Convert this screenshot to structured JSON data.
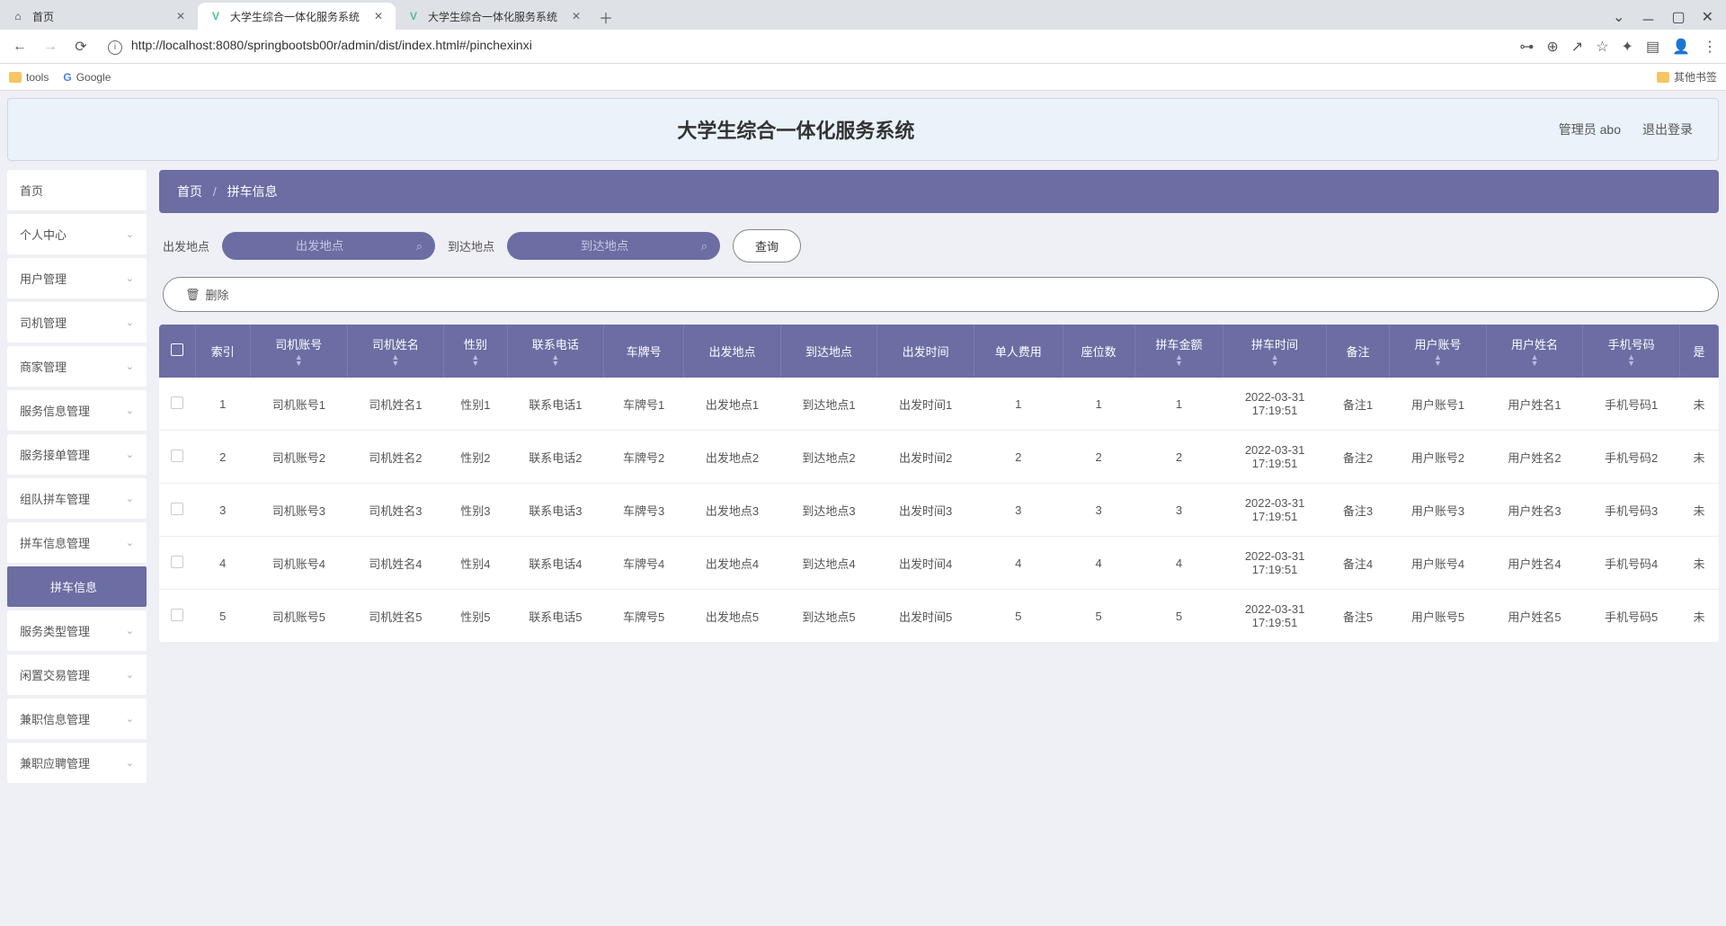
{
  "browser": {
    "tabs": [
      {
        "icon": "⌂",
        "label": "首页"
      },
      {
        "icon": "V",
        "label": "大学生综合一体化服务系统"
      },
      {
        "icon": "V",
        "label": "大学生综合一体化服务系统"
      }
    ],
    "url": "http://localhost:8080/springbootsb00r/admin/dist/index.html#/pinchexinxi",
    "bookmarks": {
      "tools": "tools",
      "google": "Google",
      "other": "其他书签"
    }
  },
  "header": {
    "title": "大学生综合一体化服务系统",
    "admin": "管理员 abo",
    "logout": "退出登录"
  },
  "sidebar": {
    "items": [
      {
        "label": "首页",
        "expandable": false
      },
      {
        "label": "个人中心",
        "expandable": true
      },
      {
        "label": "用户管理",
        "expandable": true
      },
      {
        "label": "司机管理",
        "expandable": true
      },
      {
        "label": "商家管理",
        "expandable": true
      },
      {
        "label": "服务信息管理",
        "expandable": true
      },
      {
        "label": "服务接单管理",
        "expandable": true
      },
      {
        "label": "组队拼车管理",
        "expandable": true
      },
      {
        "label": "拼车信息管理",
        "expandable": true,
        "sub": {
          "label": "拼车信息"
        }
      },
      {
        "label": "服务类型管理",
        "expandable": true
      },
      {
        "label": "闲置交易管理",
        "expandable": true
      },
      {
        "label": "兼职信息管理",
        "expandable": true
      },
      {
        "label": "兼职应聘管理",
        "expandable": true
      }
    ]
  },
  "breadcrumb": {
    "home": "首页",
    "current": "拼车信息"
  },
  "search": {
    "depart_label": "出发地点",
    "depart_placeholder": "出发地点",
    "arrive_label": "到达地点",
    "arrive_placeholder": "到达地点",
    "query": "查询"
  },
  "actions": {
    "delete": "删除"
  },
  "table": {
    "headers": [
      "",
      "索引",
      "司机账号",
      "司机姓名",
      "性别",
      "联系电话",
      "车牌号",
      "出发地点",
      "到达地点",
      "出发时间",
      "单人费用",
      "座位数",
      "拼车金额",
      "拼车时间",
      "备注",
      "用户账号",
      "用户姓名",
      "手机号码",
      "是"
    ],
    "rows": [
      {
        "idx": "1",
        "acc": "司机账号1",
        "name": "司机姓名1",
        "sex": "性别1",
        "tel": "联系电话1",
        "plate": "车牌号1",
        "from": "出发地点1",
        "to": "到达地点1",
        "dtime": "出发时间1",
        "fee": "1",
        "seat": "1",
        "amt": "1",
        "ptime": "2022-03-31 17:19:51",
        "note": "备注1",
        "uacc": "用户账号1",
        "uname": "用户姓名1",
        "phone": "手机号码1",
        "last": "未"
      },
      {
        "idx": "2",
        "acc": "司机账号2",
        "name": "司机姓名2",
        "sex": "性别2",
        "tel": "联系电话2",
        "plate": "车牌号2",
        "from": "出发地点2",
        "to": "到达地点2",
        "dtime": "出发时间2",
        "fee": "2",
        "seat": "2",
        "amt": "2",
        "ptime": "2022-03-31 17:19:51",
        "note": "备注2",
        "uacc": "用户账号2",
        "uname": "用户姓名2",
        "phone": "手机号码2",
        "last": "未"
      },
      {
        "idx": "3",
        "acc": "司机账号3",
        "name": "司机姓名3",
        "sex": "性别3",
        "tel": "联系电话3",
        "plate": "车牌号3",
        "from": "出发地点3",
        "to": "到达地点3",
        "dtime": "出发时间3",
        "fee": "3",
        "seat": "3",
        "amt": "3",
        "ptime": "2022-03-31 17:19:51",
        "note": "备注3",
        "uacc": "用户账号3",
        "uname": "用户姓名3",
        "phone": "手机号码3",
        "last": "未"
      },
      {
        "idx": "4",
        "acc": "司机账号4",
        "name": "司机姓名4",
        "sex": "性别4",
        "tel": "联系电话4",
        "plate": "车牌号4",
        "from": "出发地点4",
        "to": "到达地点4",
        "dtime": "出发时间4",
        "fee": "4",
        "seat": "4",
        "amt": "4",
        "ptime": "2022-03-31 17:19:51",
        "note": "备注4",
        "uacc": "用户账号4",
        "uname": "用户姓名4",
        "phone": "手机号码4",
        "last": "未"
      },
      {
        "idx": "5",
        "acc": "司机账号5",
        "name": "司机姓名5",
        "sex": "性别5",
        "tel": "联系电话5",
        "plate": "车牌号5",
        "from": "出发地点5",
        "to": "到达地点5",
        "dtime": "出发时间5",
        "fee": "5",
        "seat": "5",
        "amt": "5",
        "ptime": "2022-03-31 17:19:51",
        "note": "备注5",
        "uacc": "用户账号5",
        "uname": "用户姓名5",
        "phone": "手机号码5",
        "last": "未"
      }
    ]
  }
}
